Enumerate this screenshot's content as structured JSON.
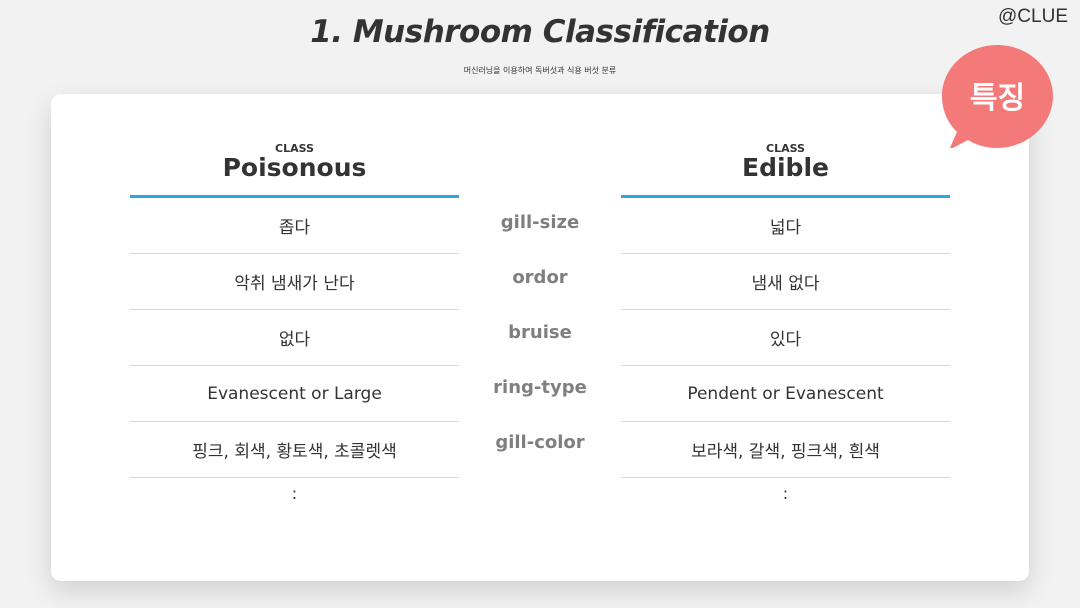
{
  "slide": {
    "title": "1.  Mushroom Classification",
    "subtitle": "머신러닝을 이용하여 독버섯과 식용 버섯 분류",
    "brand": "@CLUE",
    "badge_label": "특징",
    "badge_color": "#f47a7a",
    "accent_color": "#2aa6e0"
  },
  "table": {
    "poisonous": {
      "class_label": "CLASS",
      "name": "Poisonous",
      "values": [
        "좁다",
        "악취 냄새가 난다",
        "없다",
        "Evanescent or Large",
        "핑크, 회색, 황토색, 초콜렛색"
      ],
      "more": ":"
    },
    "features": [
      "gill-size",
      "ordor",
      "bruise",
      "ring-type",
      "gill-color"
    ],
    "edible": {
      "class_label": "CLASS",
      "name": "Edible",
      "values": [
        "넓다",
        "냄새 없다",
        "있다",
        "Pendent or Evanescent",
        "보라색, 갈색, 핑크색, 흰색"
      ],
      "more": ":"
    }
  }
}
